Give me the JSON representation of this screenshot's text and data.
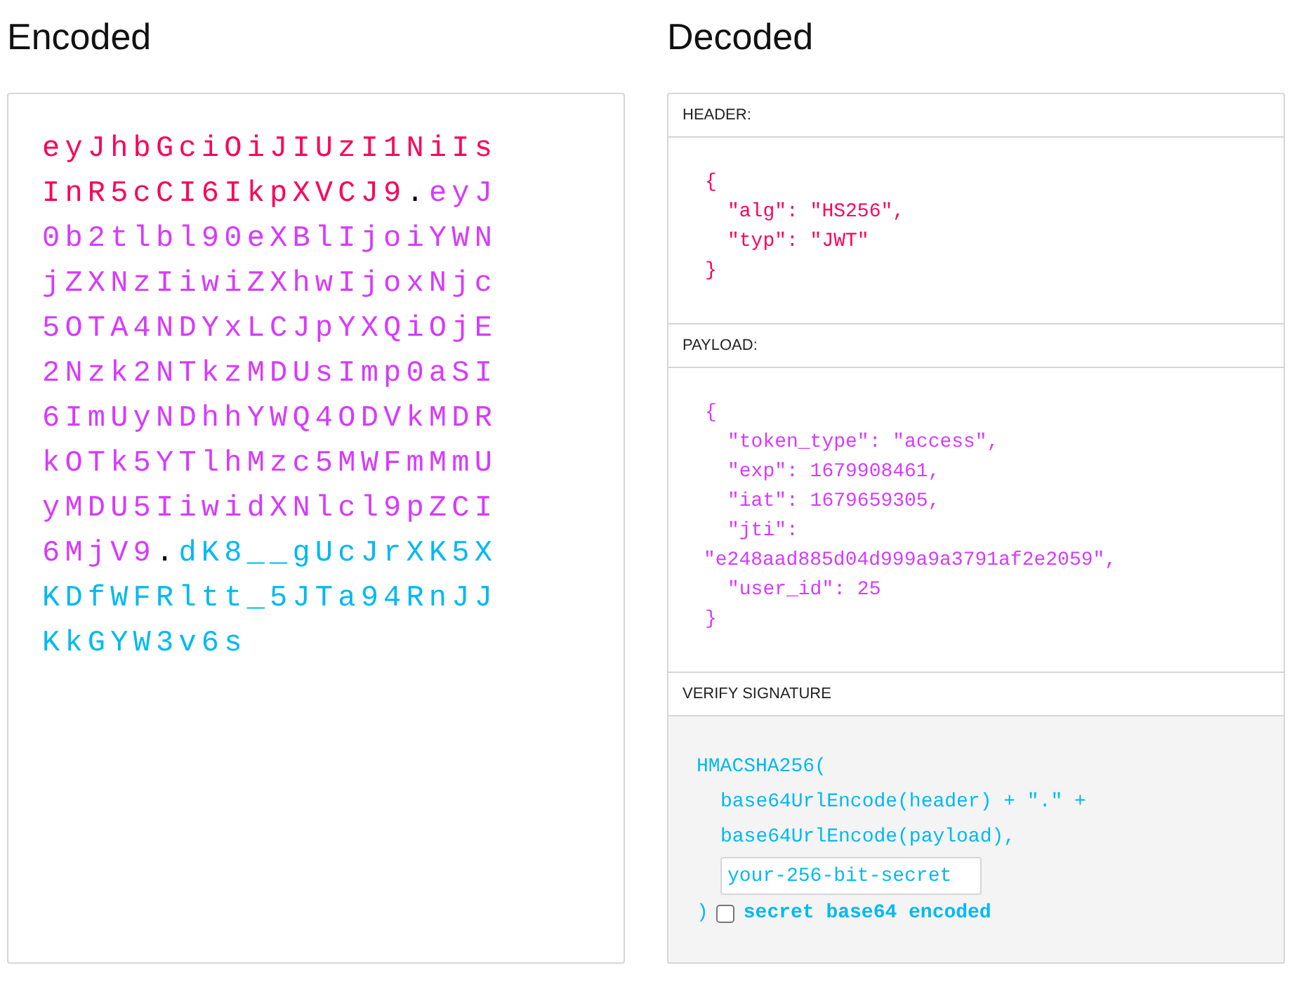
{
  "encoded": {
    "title": "Encoded",
    "parts": [
      {
        "kind": "header",
        "text": "eyJhbGciOiJIUzI1NiIsInR5cCI6IkpXVCJ9"
      },
      {
        "kind": "payload",
        "text": "eyJ0b2tlbl90eXBlIjoiYWNjZXNzIiwiZXhwIjoxNjc5OTA4NDYxLCJpYXQiOjE2Nzk2NTkzMDUsImp0aSI6ImUyNDhhYWQ4ODVkMDRkOTk5YTlhMzc5MWFmMmUyMDU5IiwidXNlcl9pZCI6MjV9"
      },
      {
        "kind": "signature",
        "text": "dK8__gUcJrXK5XKDfWFRltt_5JTa94RnJJKkGYW3v6s"
      }
    ],
    "separator": "."
  },
  "decoded": {
    "title": "Decoded",
    "header": {
      "label": "HEADER:",
      "lines": [
        {
          "kind": "brace",
          "text": "{"
        },
        {
          "kind": "entry",
          "text": "\"alg\": \"HS256\","
        },
        {
          "kind": "entry",
          "text": "\"typ\": \"JWT\""
        },
        {
          "kind": "brace",
          "text": "}"
        }
      ]
    },
    "payload": {
      "label": "PAYLOAD:",
      "lines": [
        {
          "kind": "brace",
          "text": "{"
        },
        {
          "kind": "entry",
          "text": "\"token_type\": \"access\","
        },
        {
          "kind": "entry",
          "text": "\"exp\": 1679908461,"
        },
        {
          "kind": "entry",
          "text": "\"iat\": 1679659305,"
        },
        {
          "kind": "entry",
          "text": "\"jti\":"
        },
        {
          "kind": "wrap",
          "text": "\"e248aad885d04d999a9a3791af2e2059\","
        },
        {
          "kind": "entry",
          "text": "\"user_id\": 25"
        },
        {
          "kind": "brace",
          "text": "}"
        }
      ]
    },
    "signature": {
      "label": "VERIFY SIGNATURE",
      "function": "HMACSHA256(",
      "args": [
        "base64UrlEncode(header) + \".\" +",
        "base64UrlEncode(payload),"
      ],
      "secret": {
        "placeholder": "your-256-bit-secret"
      },
      "close": ")",
      "base64": {
        "label": "secret base64 encoded",
        "checked": false
      }
    }
  }
}
